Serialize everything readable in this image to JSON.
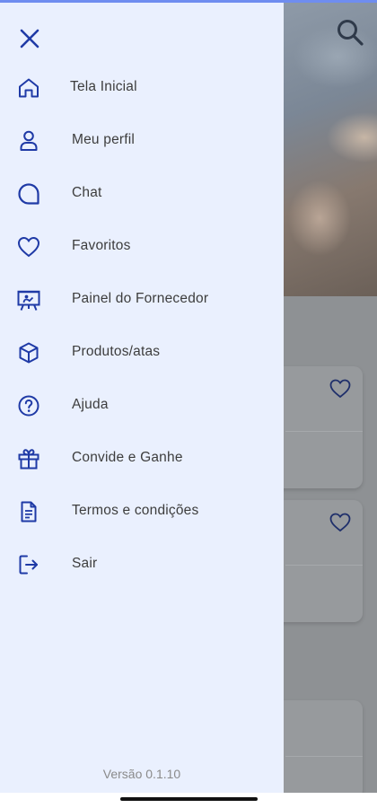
{
  "colors": {
    "accent": "#1f3aa6",
    "drawer_bg": "#eaf0fe",
    "label_text": "#3d3d3d",
    "version_text": "#8a8a8a"
  },
  "drawer": {
    "close_icon": "close-icon",
    "menu": [
      {
        "id": "home",
        "label": "Tela Inicial",
        "icon": "home-icon"
      },
      {
        "id": "profile",
        "label": "Meu perfil",
        "icon": "user-icon"
      },
      {
        "id": "chat",
        "label": "Chat",
        "icon": "chat-icon"
      },
      {
        "id": "favorites",
        "label": "Favoritos",
        "icon": "heart-icon"
      },
      {
        "id": "supplier-panel",
        "label": "Painel do Fornecedor",
        "icon": "presentation-board-icon"
      },
      {
        "id": "products",
        "label": "Produtos/atas",
        "icon": "box-icon"
      },
      {
        "id": "help",
        "label": "Ajuda",
        "icon": "help-circle-icon"
      },
      {
        "id": "invite",
        "label": "Convide e Ganhe",
        "icon": "gift-icon"
      },
      {
        "id": "terms",
        "label": "Termos e condições",
        "icon": "document-icon"
      },
      {
        "id": "logout",
        "label": "Sair",
        "icon": "logout-icon"
      }
    ],
    "version": "Versão 0.1.10"
  },
  "background": {
    "search_icon": "search-icon",
    "favorite_icon": "heart-outline-icon"
  }
}
